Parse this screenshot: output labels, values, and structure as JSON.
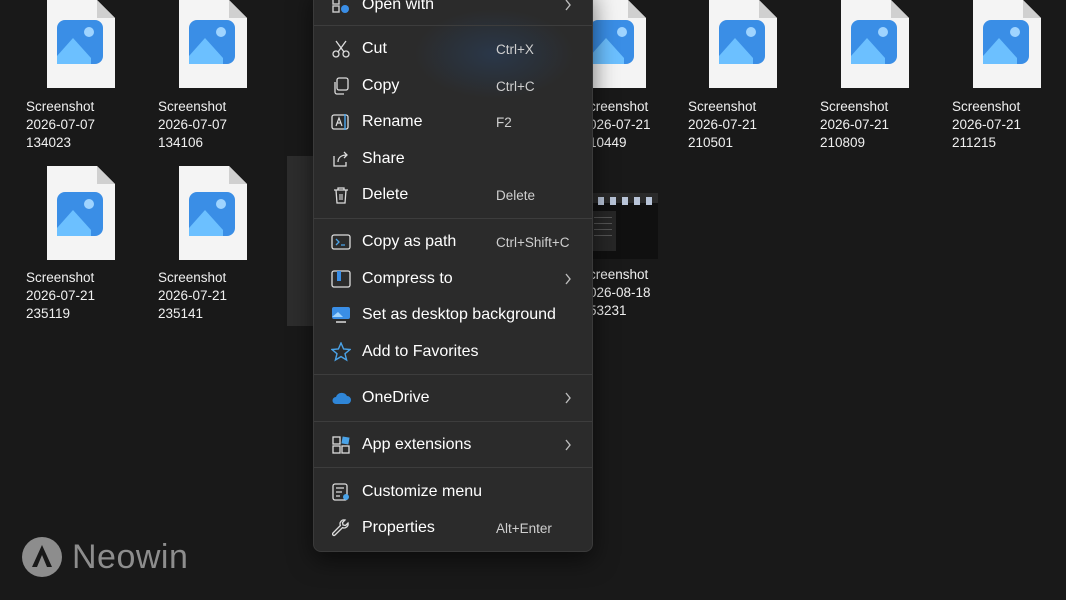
{
  "files": [
    {
      "lines": [
        "Screenshot",
        "2026-07-07",
        "134023"
      ]
    },
    {
      "lines": [
        "Screenshot",
        "2026-07-07",
        "134106"
      ]
    },
    {
      "lines": [
        "creenshot",
        "026-07-21",
        "10449"
      ]
    },
    {
      "lines": [
        "Screenshot",
        "2026-07-21",
        "210501"
      ]
    },
    {
      "lines": [
        "Screenshot",
        "2026-07-21",
        "210809"
      ]
    },
    {
      "lines": [
        "Screenshot",
        "2026-07-21",
        "211215"
      ]
    },
    {
      "lines": [
        "Screenshot",
        "2026-07-21",
        "235119"
      ]
    },
    {
      "lines": [
        "Screenshot",
        "2026-07-21",
        "235141"
      ]
    },
    {
      "lines": [
        "creenshot",
        "026-08-18",
        "53231"
      ]
    }
  ],
  "menu": {
    "open_with": "Open with",
    "cut": {
      "label": "Cut",
      "shortcut": "Ctrl+X"
    },
    "copy": {
      "label": "Copy",
      "shortcut": "Ctrl+C"
    },
    "rename": {
      "label": "Rename",
      "shortcut": "F2"
    },
    "share": {
      "label": "Share"
    },
    "delete": {
      "label": "Delete",
      "shortcut": "Delete"
    },
    "copy_as_path": {
      "label": "Copy as path",
      "shortcut": "Ctrl+Shift+C"
    },
    "compress_to": {
      "label": "Compress to"
    },
    "set_desktop_bg": {
      "label": "Set as desktop background"
    },
    "add_favorites": {
      "label": "Add to Favorites"
    },
    "onedrive": {
      "label": "OneDrive"
    },
    "app_extensions": {
      "label": "App extensions"
    },
    "customize_menu": {
      "label": "Customize menu"
    },
    "properties": {
      "label": "Properties",
      "shortcut": "Alt+Enter"
    }
  },
  "watermark": "Neowin",
  "colors": {
    "background": "#191919",
    "menu": "#2b2b2b",
    "icon_blue": "#4aa3e8",
    "onedrive": "#2f86d8"
  }
}
